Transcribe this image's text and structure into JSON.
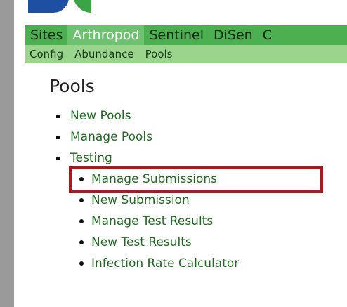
{
  "nav": {
    "main": [
      "Sites",
      "Arthropod",
      "Sentinel",
      "DiSen",
      "C"
    ],
    "active_main": "Arthropod",
    "sub": [
      "Config",
      "Abundance",
      "Pools"
    ]
  },
  "page": {
    "title": "Pools"
  },
  "menu": {
    "items": [
      "New Pools",
      "Manage Pools",
      "Testing"
    ],
    "testing_items": [
      "Manage Submissions",
      "New Submission",
      "Manage Test Results",
      "New Test Results",
      "Infection Rate Calculator"
    ]
  },
  "colors": {
    "nav_main_bg": "#4caf50",
    "nav_active_bg": "#6cc26f",
    "nav_sub_bg": "#9bd58d",
    "link": "#1f6b1f",
    "highlight": "#b1141b"
  }
}
